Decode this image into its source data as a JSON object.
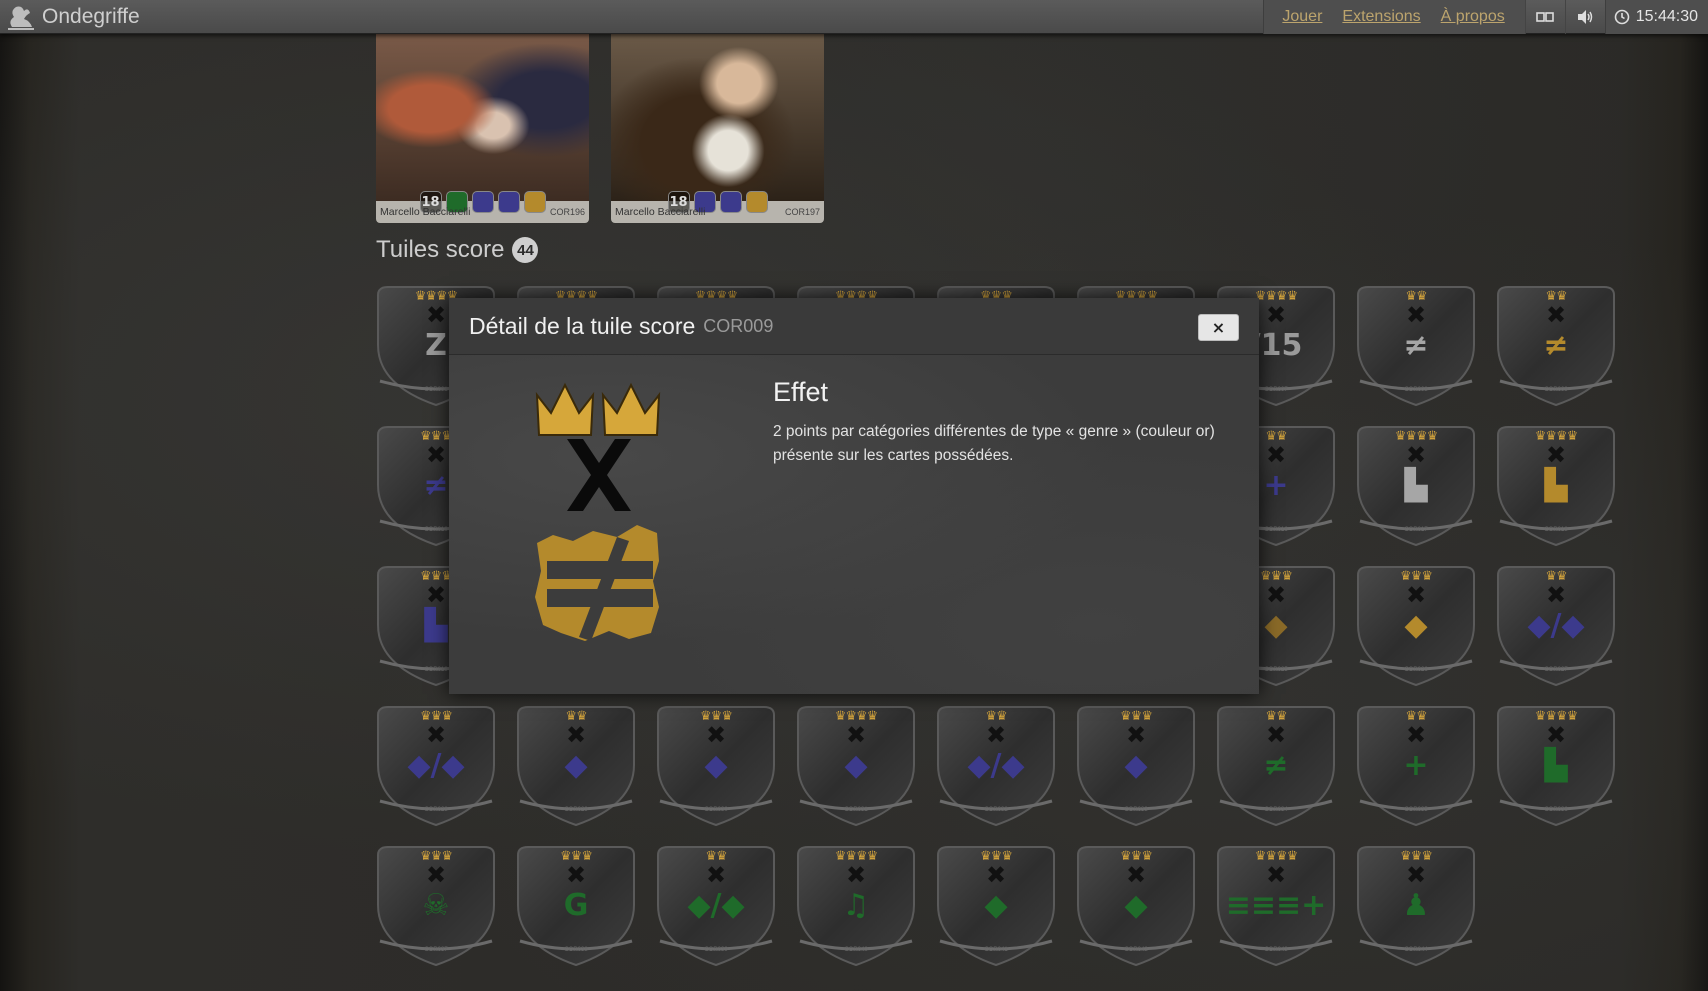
{
  "app": {
    "name": "Ondegriffe"
  },
  "nav": {
    "links": [
      "Jouer",
      "Extensions",
      "À propos"
    ],
    "time": "15:44:30"
  },
  "cards": [
    {
      "artist": "Marcello Bacciarelli",
      "code": "COR196",
      "icons": [
        "18",
        "green",
        "blue",
        "blue",
        "gold"
      ]
    },
    {
      "artist": "Marcello Bacciarelli",
      "code": "COR197",
      "icons": [
        "18",
        "blue",
        "blue",
        "gold"
      ]
    }
  ],
  "section": {
    "title": "Tuiles score",
    "count": "44"
  },
  "tiles": [
    {
      "code": "COR001",
      "crowns": 4,
      "sym": "Z",
      "color": "#9a9a9a"
    },
    {
      "code": "COR002",
      "crowns": 4,
      "sym": "",
      "color": "#9a9a9a"
    },
    {
      "code": "COR003",
      "crowns": 4,
      "sym": "",
      "color": "#9a9a9a"
    },
    {
      "code": "COR004",
      "crowns": 4,
      "sym": "",
      "color": "#9a9a9a"
    },
    {
      "code": "COR005",
      "crowns": 3,
      "sym": "",
      "color": "#9a9a9a"
    },
    {
      "code": "COR006",
      "crowns": 4,
      "sym": "",
      "color": "#9a9a9a"
    },
    {
      "code": "COR007",
      "crowns": 4,
      "sym": "/15",
      "color": "#9a9a9a"
    },
    {
      "code": "COR008",
      "crowns": 2,
      "sym": "≠",
      "color": "#a6a6a6"
    },
    {
      "code": "COR009",
      "crowns": 2,
      "sym": "≠",
      "color": "#b48a2c"
    },
    {
      "code": "COR010",
      "crowns": 3,
      "sym": "≠",
      "color": "#3c3a8c"
    },
    {
      "code": "COR011",
      "crowns": 0,
      "sym": "",
      "color": "#555"
    },
    {
      "code": "COR012",
      "crowns": 0,
      "sym": "",
      "color": "#555"
    },
    {
      "code": "COR013",
      "crowns": 0,
      "sym": "",
      "color": "#555"
    },
    {
      "code": "COR014",
      "crowns": 0,
      "sym": "",
      "color": "#555"
    },
    {
      "code": "COR015",
      "crowns": 0,
      "sym": "",
      "color": "#555"
    },
    {
      "code": "COR016",
      "crowns": 2,
      "sym": "+",
      "color": "#3c3a8c"
    },
    {
      "code": "COR017",
      "crowns": 4,
      "sym": "▙",
      "color": "#a6a6a6"
    },
    {
      "code": "COR018",
      "crowns": 4,
      "sym": "▙",
      "color": "#b48a2c"
    },
    {
      "code": "COR019",
      "crowns": 3,
      "sym": "▙",
      "color": "#3c3a8c"
    },
    {
      "code": "COR020",
      "crowns": 0,
      "sym": "",
      "color": "#555"
    },
    {
      "code": "COR021",
      "crowns": 0,
      "sym": "",
      "color": "#555"
    },
    {
      "code": "COR022",
      "crowns": 0,
      "sym": "",
      "color": "#555"
    },
    {
      "code": "COR023",
      "crowns": 0,
      "sym": "",
      "color": "#555"
    },
    {
      "code": "COR024",
      "crowns": 0,
      "sym": "",
      "color": "#555"
    },
    {
      "code": "COR025",
      "crowns": 3,
      "sym": "◆",
      "color": "#8a6a28"
    },
    {
      "code": "COR026",
      "crowns": 3,
      "sym": "◆",
      "color": "#b48a2c"
    },
    {
      "code": "COR027",
      "crowns": 2,
      "sym": "◆/◆",
      "color": "#3c3a8c"
    },
    {
      "code": "COR028",
      "crowns": 3,
      "sym": "◆/◆",
      "color": "#3c3a8c"
    },
    {
      "code": "COR029",
      "crowns": 2,
      "sym": "◆",
      "color": "#3c3a8c"
    },
    {
      "code": "COR030",
      "crowns": 3,
      "sym": "◆",
      "color": "#3c3a8c"
    },
    {
      "code": "COR031",
      "crowns": 4,
      "sym": "◆",
      "color": "#3c3a8c"
    },
    {
      "code": "COR032",
      "crowns": 2,
      "sym": "◆/◆",
      "color": "#3c3a8c"
    },
    {
      "code": "COR033",
      "crowns": 3,
      "sym": "◆",
      "color": "#3c3a8c"
    },
    {
      "code": "COR034",
      "crowns": 2,
      "sym": "≠",
      "color": "#1f6b2a"
    },
    {
      "code": "COR035",
      "crowns": 2,
      "sym": "+",
      "color": "#1f6b2a"
    },
    {
      "code": "COR036",
      "crowns": 4,
      "sym": "▙",
      "color": "#1f6b2a"
    },
    {
      "code": "COR037",
      "crowns": 3,
      "sym": "☠",
      "color": "#1f6b2a"
    },
    {
      "code": "COR038",
      "crowns": 3,
      "sym": "G",
      "color": "#1f6b2a"
    },
    {
      "code": "COR039",
      "crowns": 2,
      "sym": "◆/◆",
      "color": "#1f6b2a"
    },
    {
      "code": "COR040",
      "crowns": 4,
      "sym": "♫",
      "color": "#1f6b2a"
    },
    {
      "code": "COR041",
      "crowns": 3,
      "sym": "◆",
      "color": "#1f6b2a"
    },
    {
      "code": "COR042",
      "crowns": 3,
      "sym": "◆",
      "color": "#1f6b2a"
    },
    {
      "code": "COR043",
      "crowns": 4,
      "sym": "≡≡≡+",
      "color": "#1f6b2a"
    },
    {
      "code": "COR044",
      "crowns": 3,
      "sym": "♟",
      "color": "#1f6b2a"
    }
  ],
  "modal": {
    "title": "Détail de la tuile score",
    "code": "COR009",
    "effect_title": "Effet",
    "effect_text": "2 points par catégories différentes de type « genre » (couleur or) présente sur les cartes possédées.",
    "close_label": "×"
  }
}
